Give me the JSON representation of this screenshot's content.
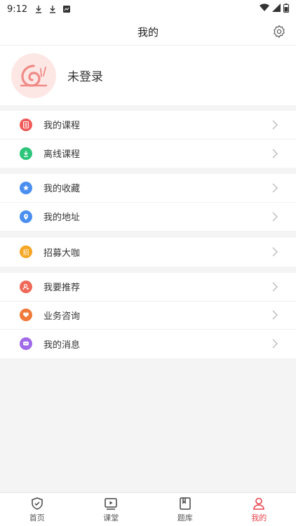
{
  "status_bar": {
    "time": "9:12"
  },
  "header": {
    "title": "我的"
  },
  "profile": {
    "login_text": "未登录"
  },
  "menu_groups": [
    [
      {
        "label": "我的课程",
        "icon": "course-icon",
        "color": "#f05a5a"
      },
      {
        "label": "离线课程",
        "icon": "download-icon",
        "color": "#2cc57a"
      }
    ],
    [
      {
        "label": "我的收藏",
        "icon": "star-icon",
        "color": "#4a8ff0"
      },
      {
        "label": "我的地址",
        "icon": "location-icon",
        "color": "#4a8ff0"
      }
    ],
    [
      {
        "label": "招募大咖",
        "icon": "recruit-icon",
        "color": "#f5a623",
        "glyph": "招"
      }
    ],
    [
      {
        "label": "我要推荐",
        "icon": "recommend-icon",
        "color": "#f06a5a"
      },
      {
        "label": "业务咨询",
        "icon": "consult-icon",
        "color": "#f07a3a"
      },
      {
        "label": "我的消息",
        "icon": "message-icon",
        "color": "#a06ae8"
      }
    ]
  ],
  "tabbar": [
    {
      "label": "首页",
      "icon": "home-shield-icon",
      "active": false
    },
    {
      "label": "课堂",
      "icon": "video-play-icon",
      "active": false
    },
    {
      "label": "题库",
      "icon": "book-icon",
      "active": false
    },
    {
      "label": "我的",
      "icon": "user-icon",
      "active": true
    }
  ],
  "colors": {
    "accent": "#e8414b",
    "background": "#f4f4f4"
  }
}
